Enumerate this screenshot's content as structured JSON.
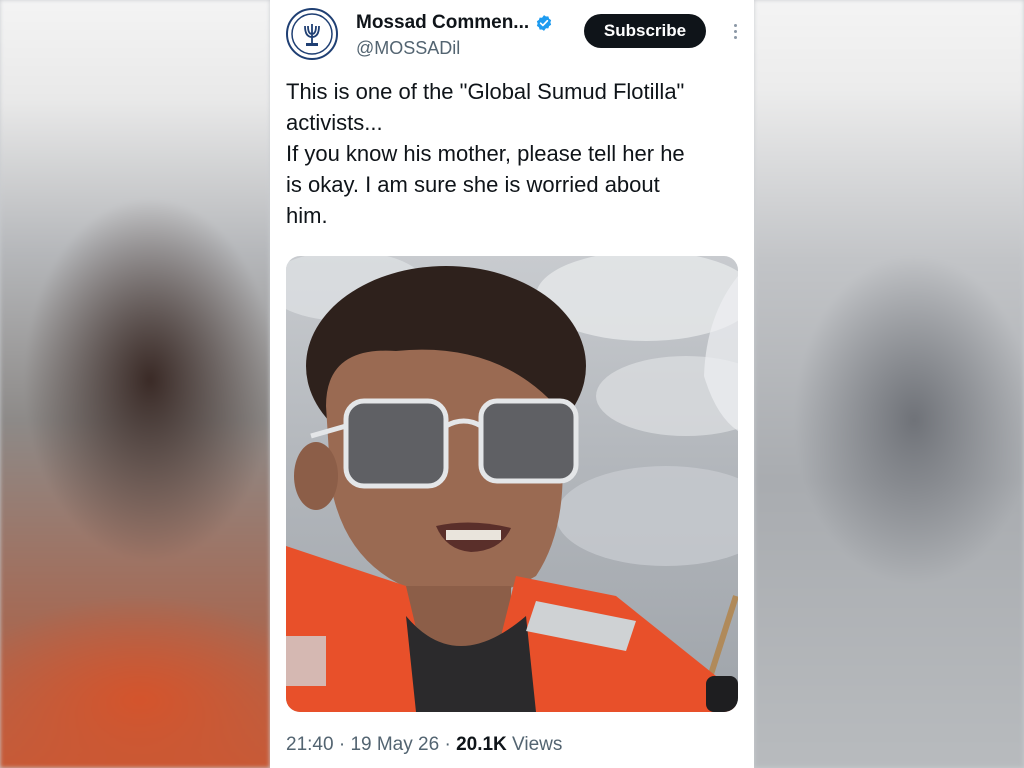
{
  "account": {
    "name": "Mossad Commen...",
    "handle": "@MOSSADil",
    "verified": true,
    "avatar_icon": "menorah-icon"
  },
  "actions": {
    "subscribe_label": "Subscribe",
    "more_icon": "more-vertical-icon"
  },
  "tweet": {
    "lines": [
      "This is one of the \"Global Sumud Flotilla\"",
      "activists...",
      "If you know his mother, please tell her he",
      "is okay. I am sure she is worried about",
      "him."
    ]
  },
  "meta": {
    "time": "21:40",
    "date": "19 May 26",
    "views_count": "20.1K",
    "views_label": "Views"
  },
  "colors": {
    "verified_badge": "#1d9bf0",
    "subscribe_bg": "#0f1419",
    "life_jacket": "#e8502a"
  }
}
